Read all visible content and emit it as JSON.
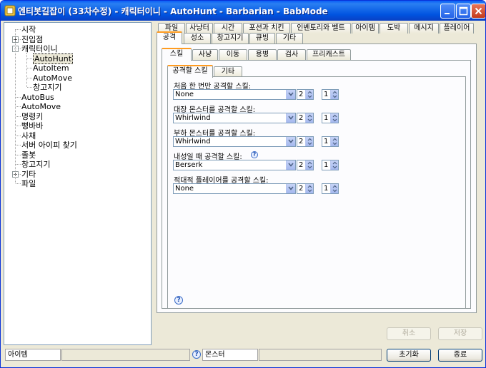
{
  "window": {
    "title": "엔티봇길잡이 (33차수정) - 캐릭터이니 - AutoHunt - Barbarian - BabMode",
    "minimize_label": "minimize",
    "maximize_label": "maximize",
    "close_label": "close"
  },
  "tree": {
    "items": [
      {
        "label": "시작",
        "level": 0
      },
      {
        "label": "진입점",
        "level": 0,
        "expander": "+"
      },
      {
        "label": "캐릭터이니",
        "level": 0,
        "expander": "-"
      },
      {
        "label": "AutoHunt",
        "level": 1,
        "selected": true
      },
      {
        "label": "AutoItem",
        "level": 1
      },
      {
        "label": "AutoMove",
        "level": 1
      },
      {
        "label": "창고지기",
        "level": 1
      },
      {
        "label": "AutoBus",
        "level": 0
      },
      {
        "label": "AutoMove",
        "level": 0
      },
      {
        "label": "명령키",
        "level": 0
      },
      {
        "label": "뻥바바",
        "level": 0
      },
      {
        "label": "사채",
        "level": 0
      },
      {
        "label": "서버 아이피 찾기",
        "level": 0
      },
      {
        "label": "졸봇",
        "level": 0
      },
      {
        "label": "창고지기",
        "level": 0
      },
      {
        "label": "기타",
        "level": 0,
        "expander": "+"
      },
      {
        "label": "파일",
        "level": 0
      }
    ]
  },
  "tabs_row1": [
    "파일",
    "사냥터",
    "시간",
    "포션과 치킨",
    "인벤토리와 벨트",
    "아이템",
    "도박",
    "메시지",
    "플레이어"
  ],
  "tabs_row2": [
    "공격",
    "성소",
    "창고지기",
    "큐빙",
    "기타"
  ],
  "tabs_row2_active": "공격",
  "subtabs": [
    "스킬",
    "사냥",
    "이동",
    "용병",
    "검사",
    "프리캐스트"
  ],
  "subtabs_active": "스킬",
  "innertabs": [
    "공격할 스킬",
    "기타"
  ],
  "innertabs_active": "공격할 스킬",
  "skill_rows": [
    {
      "label": "처음 한 번만 공격할 스킬:",
      "value": "None",
      "count": "2",
      "level": "1"
    },
    {
      "label": "대장 몬스터를 공격할 스킬:",
      "value": "Whirlwind",
      "count": "2",
      "level": "1"
    },
    {
      "label": "부하 몬스터를 공격할 스킬:",
      "value": "Whirlwind",
      "count": "2",
      "level": "1"
    },
    {
      "label": "내성일 때 공격할 스킬:",
      "value": "Berserk",
      "count": "2",
      "level": "1",
      "help": true
    },
    {
      "label": "적대적 플레이어를 공격할 스킬:",
      "value": "None",
      "count": "2",
      "level": "1"
    }
  ],
  "help_glyph": "?",
  "buttons": {
    "cancel": "취소",
    "save": "저장",
    "reset": "초기화",
    "exit": "종료"
  },
  "status": {
    "left": "아이템",
    "middle": "",
    "right": "몬스터",
    "far_right": ""
  }
}
